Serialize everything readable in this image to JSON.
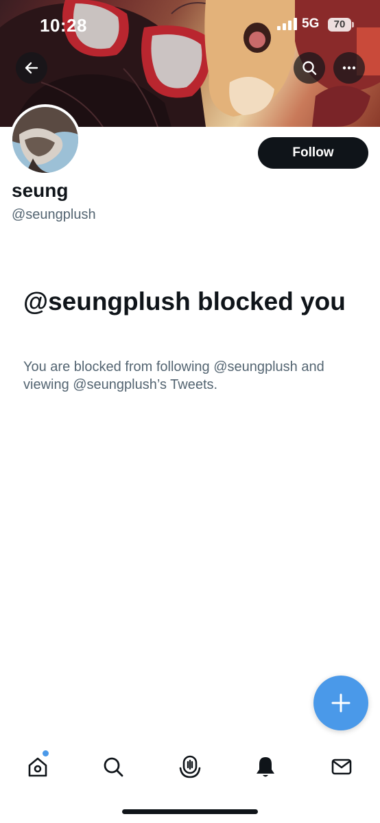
{
  "status_bar": {
    "time": "10:28",
    "network": "5G",
    "battery": "70"
  },
  "profile": {
    "display_name": "seung",
    "handle": "@seungplush",
    "follow_label": "Follow"
  },
  "blocked": {
    "title": "@seungplush blocked you",
    "description": "You are blocked from following @seungplush and viewing @seungplush’s Tweets."
  },
  "nav": {
    "items": [
      "home-icon",
      "search-icon",
      "spaces-icon",
      "notifications-icon",
      "messages-icon"
    ],
    "home_has_unread": true
  },
  "colors": {
    "accent": "#4a99e9",
    "text": "#0f1419",
    "secondary_text": "#536471",
    "button_dark": "#0f1419"
  }
}
